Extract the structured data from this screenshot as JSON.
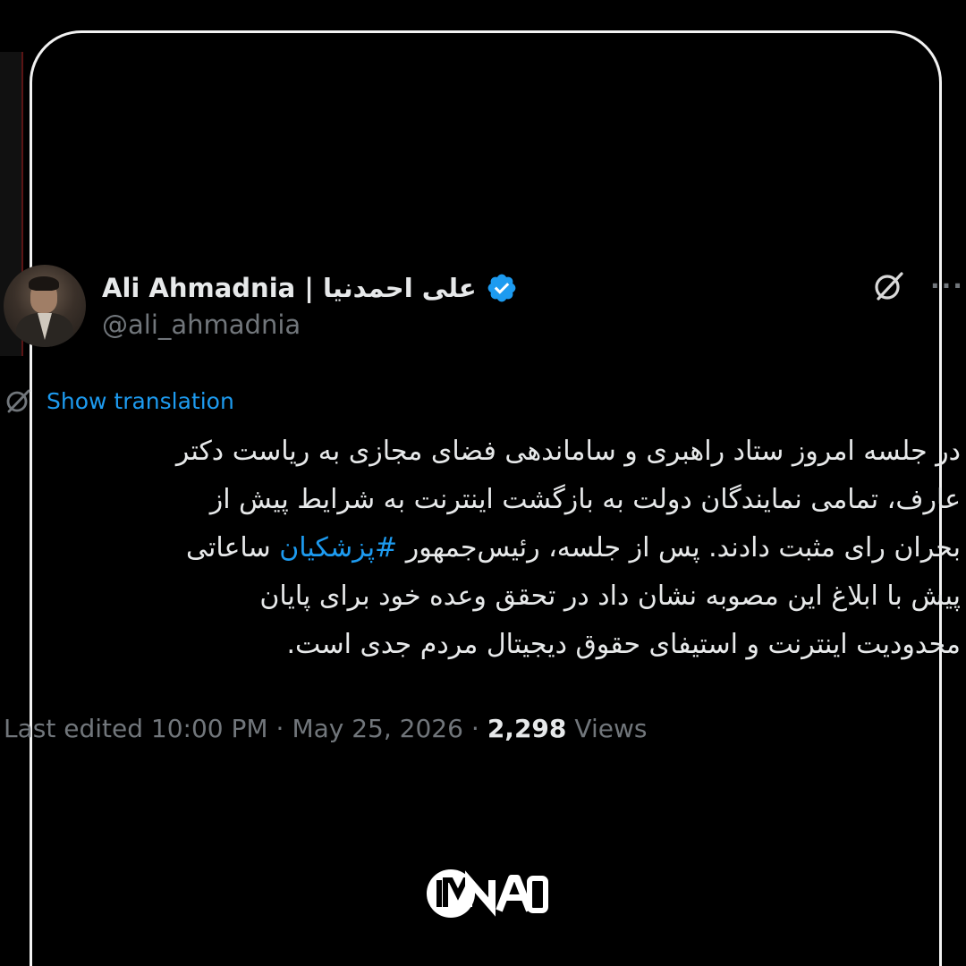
{
  "author": {
    "display_name": "Ali Ahmadnia | علی احمدنیا",
    "handle": "@ali_ahmadnia",
    "verified_icon": "verified-badge-icon"
  },
  "actions": {
    "grok_icon": "grok-icon",
    "more_icon": "more-icon"
  },
  "translate": {
    "label": "Show translation",
    "icon": "translate-icon"
  },
  "tweet": {
    "lines": [
      "در جلسه امروز ستاد راهبری و ساماندهی فضای مجازی به ریاست دکتر",
      "عارف، تمامی نمایندگان دولت به بازگشت اینترنت به شرایط پیش از"
    ],
    "line3_before": "بحران رای مثبت دادند. پس از جلسه، رئیس‌جمهور ",
    "hashtag": "#پزشکیان",
    "line3_after": " ساعاتی",
    "lines_rest": [
      "پیش با ابلاغ این مصوبه نشان داد در تحقق وعده خود برای پایان",
      "محدودیت اینترنت و استیفای حقوق دیجیتال مردم جدی است."
    ]
  },
  "meta": {
    "edited_label": "Last edited 10:00 PM",
    "separator": "·",
    "date": "May 25, 2026",
    "views_count": "2,298",
    "views_label": "Views"
  },
  "logo": {
    "text": "IMNA"
  },
  "colors": {
    "background": "#000000",
    "text": "#e7e9ea",
    "muted": "#71767b",
    "accent": "#1d9bf0",
    "frame": "#f2f2f2"
  }
}
